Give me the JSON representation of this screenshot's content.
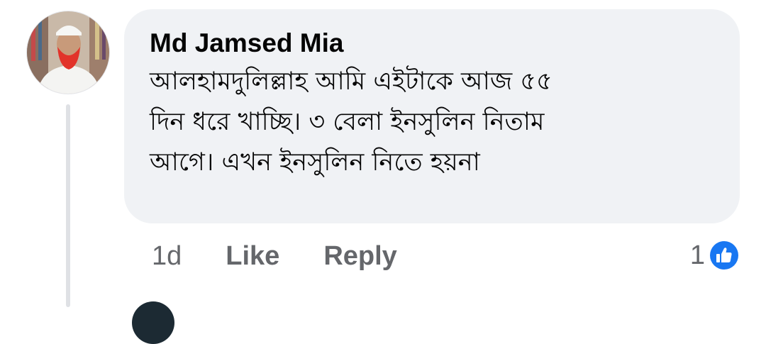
{
  "comment": {
    "author": "Md Jamsed Mia",
    "lines": [
      "আলহামদুলিল্লাহ আমি এইটাকে আজ ৫৫",
      "দিন ধরে খাচ্ছি। ৩ বেলা ইনসুলিন নিতাম",
      "আগে। এখন ইনসুলিন নিতে হয়না"
    ],
    "timestamp": "1d",
    "like_label": "Like",
    "reply_label": "Reply",
    "reaction_count": "1",
    "reaction_icon": "thumbs-up-icon"
  },
  "colors": {
    "bubble_bg": "#f0f2f5",
    "meta_text": "#65676b",
    "like_blue": "#1877f2",
    "beard_red": "#e2332a"
  }
}
